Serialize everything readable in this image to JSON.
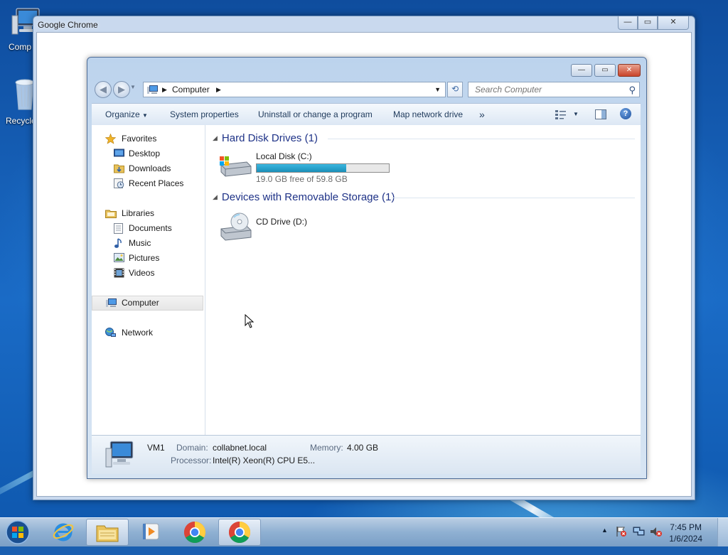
{
  "desktop": {
    "icons": [
      {
        "label": "Computer",
        "visible_label": "Comp"
      },
      {
        "label": "Recycle Bin",
        "visible_label": "Recycle"
      }
    ]
  },
  "chrome_window": {
    "title": "Google Chrome",
    "min_glyph": "—",
    "max_glyph": "▭",
    "close_glyph": "✕"
  },
  "explorer": {
    "controls": {
      "min": "—",
      "max": "▭",
      "close": "✕"
    },
    "nav": {
      "back": "◀",
      "forward": "▶",
      "dropdown": "▼"
    },
    "address": {
      "crumb": "Computer",
      "sep": "▶",
      "dropdown": "▼"
    },
    "refresh_glyph": "⟲",
    "search": {
      "placeholder": "Search Computer",
      "icon": "search-icon"
    },
    "toolbar": {
      "organize": "Organize",
      "system_properties": "System properties",
      "uninstall": "Uninstall or change a program",
      "map_drive": "Map network drive",
      "more": "»",
      "view_dropdown": "▼",
      "help": "?"
    },
    "nav_pane": {
      "favorites": "Favorites",
      "desktop": "Desktop",
      "downloads": "Downloads",
      "recent": "Recent Places",
      "libraries": "Libraries",
      "documents": "Documents",
      "music": "Music",
      "pictures": "Pictures",
      "videos": "Videos",
      "computer": "Computer",
      "network": "Network"
    },
    "groups": {
      "hdd": {
        "title": "Hard Disk Drives (1)",
        "tri": "◢"
      },
      "removable": {
        "title": "Devices with Removable Storage (1)",
        "tri": "◢"
      }
    },
    "drives": {
      "c": {
        "name": "Local Disk (C:)",
        "free_text": "19.0 GB free of 59.8 GB",
        "used_fraction": 0.68
      },
      "d": {
        "name": "CD Drive (D:)"
      }
    },
    "details": {
      "name": "VM1",
      "domain_label": "Domain:",
      "domain_value": "collabnet.local",
      "memory_label": "Memory:",
      "memory_value": "4.00 GB",
      "processor_label": "Processor:",
      "processor_value": "Intel(R) Xeon(R) CPU E5..."
    }
  },
  "taskbar": {
    "tray_arrow": "▲",
    "time": "7:45 PM",
    "date": "1/6/2024"
  },
  "colors": {
    "accent": "#1e3287",
    "bar_fill": "#26a2cc",
    "selection": "#e6e6e6"
  }
}
